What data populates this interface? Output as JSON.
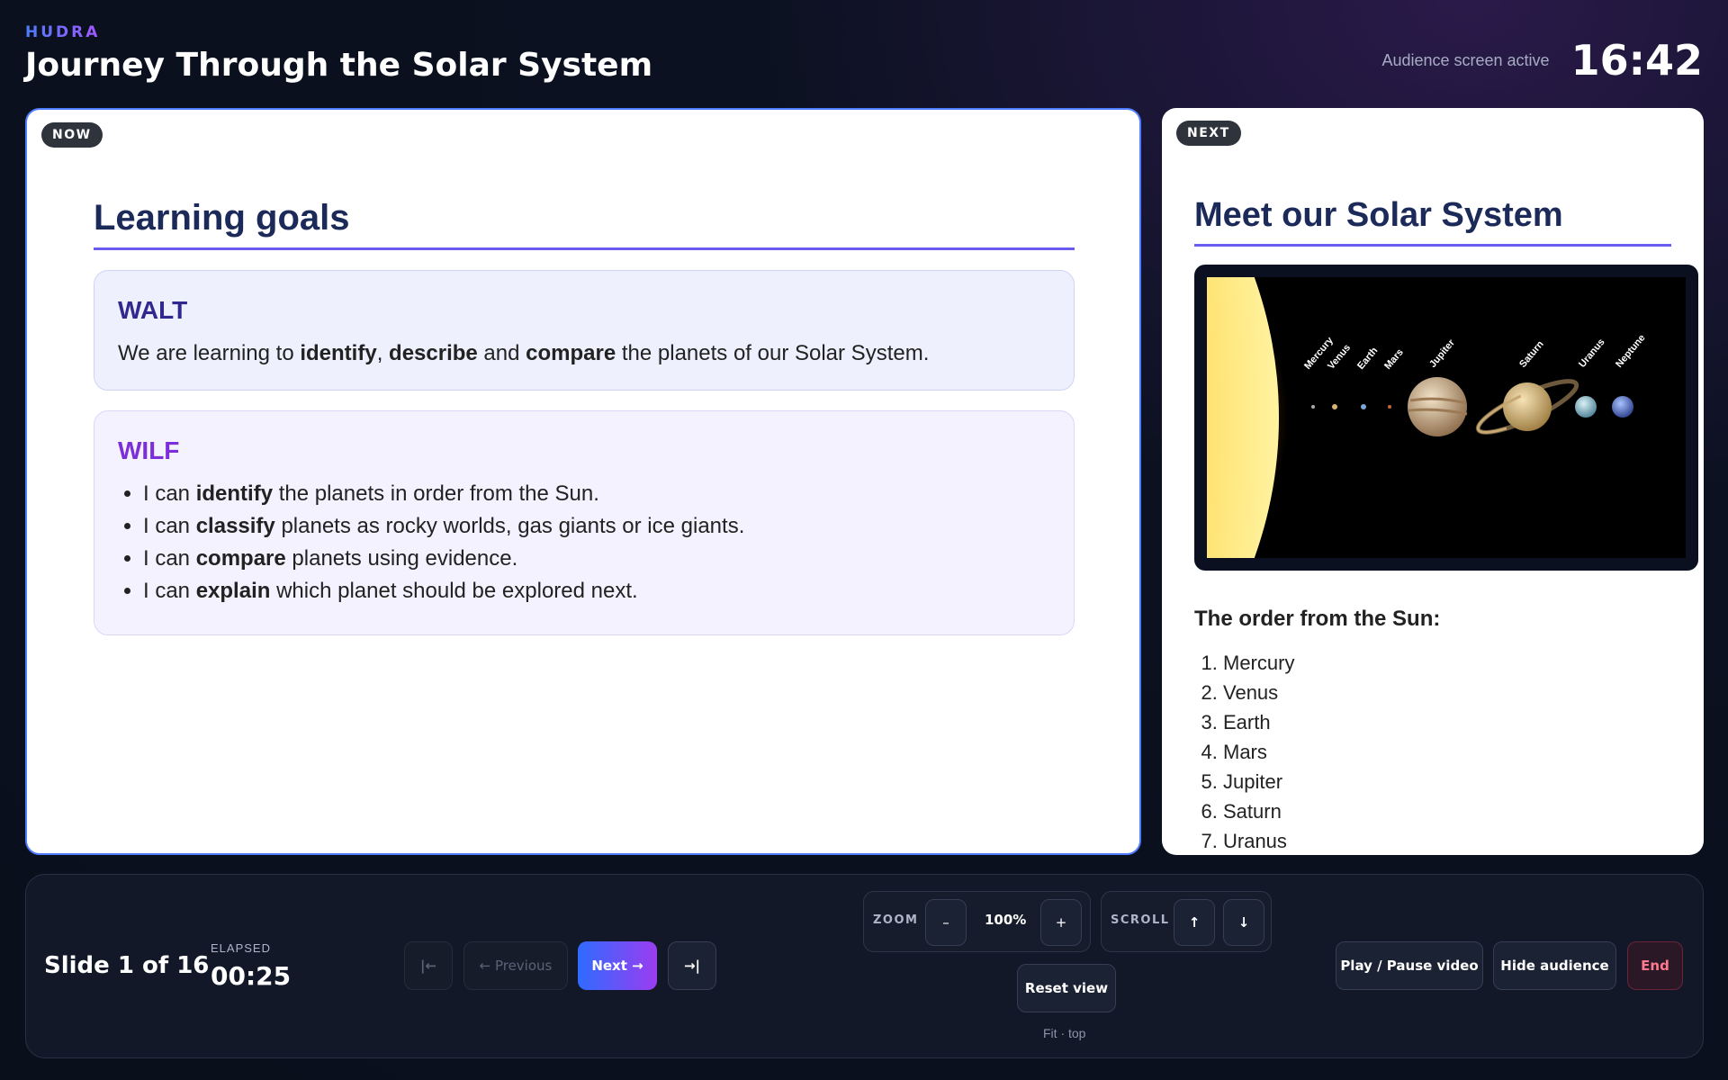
{
  "header": {
    "brand": "HUDRA",
    "title": "Journey Through the Solar System",
    "audience_status": "Audience screen active",
    "clock": "16:42"
  },
  "now_slide": {
    "badge": "NOW",
    "heading": "Learning goals",
    "walt": {
      "label": "WALT",
      "text": [
        "We are learning to ",
        "identify",
        ", ",
        "describe",
        " and ",
        "compare",
        " the planets of our Solar System."
      ]
    },
    "wilf": {
      "label": "WILF",
      "items": [
        {
          "pre": "I can ",
          "bold": "identify",
          "post": " the planets in order from the Sun."
        },
        {
          "pre": "I can ",
          "bold": "classify",
          "post": " planets as rocky worlds, gas giants or ice giants."
        },
        {
          "pre": "I can ",
          "bold": "compare",
          "post": " planets using evidence."
        },
        {
          "pre": "I can ",
          "bold": "explain",
          "post": " which planet should be explored next."
        }
      ]
    }
  },
  "next_slide": {
    "badge": "NEXT",
    "heading": "Meet our Solar System",
    "image_labels": [
      "Mercury",
      "Venus",
      "Earth",
      "Mars",
      "Jupiter",
      "Saturn",
      "Uranus",
      "Neptune"
    ],
    "order_heading": "The order from the Sun:",
    "order": [
      "Mercury",
      "Venus",
      "Earth",
      "Mars",
      "Jupiter",
      "Saturn",
      "Uranus"
    ]
  },
  "controls": {
    "slide_info": "Slide 1 of 16",
    "elapsed_label": "ELAPSED",
    "elapsed": "00:25",
    "first_label": "|←",
    "previous_label": "← Previous",
    "next_label": "Next →",
    "last_label": "→|",
    "zoom_label": "ZOOM",
    "zoom_minus": "–",
    "zoom_value": "100%",
    "zoom_plus": "+",
    "scroll_label": "SCROLL",
    "scroll_up": "↑",
    "scroll_down": "↓",
    "reset_label": "Reset view",
    "fit_label": "Fit · top",
    "play_pause_label": "Play / Pause video",
    "hide_audience_label": "Hide audience",
    "end_label": "End"
  }
}
